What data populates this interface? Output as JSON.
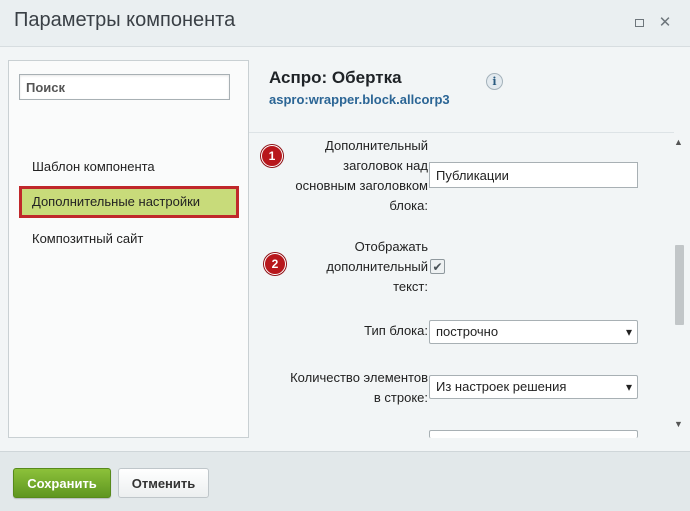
{
  "window": {
    "title": "Параметры компонента"
  },
  "sidebar": {
    "search_placeholder": "Поиск",
    "items": [
      {
        "label": "Шаблон компонента",
        "active": false
      },
      {
        "label": "Дополнительные настройки",
        "active": true
      },
      {
        "label": "Композитный сайт",
        "active": false
      }
    ]
  },
  "component": {
    "name": "Аспро: Обертка",
    "code": "aspro:wrapper.block.allcorp3",
    "info_icon_glyph": "i"
  },
  "form": {
    "fields": [
      {
        "badge": "1",
        "label": "Дополнительный заголовок над основным заголовком блока:",
        "type": "text",
        "value": "Публикации"
      },
      {
        "badge": "2",
        "label": "Отображать дополнительный текст:",
        "type": "checkbox",
        "checked": true,
        "check_glyph": "✔"
      },
      {
        "label": "Тип блока:",
        "type": "select",
        "value": "построчно"
      },
      {
        "label": "Количество элементов в строке:",
        "type": "select",
        "value": "Из настроек решения"
      }
    ]
  },
  "footer": {
    "save_label": "Сохранить",
    "cancel_label": "Отменить"
  },
  "colors": {
    "active_item_bg": "#c8db7a",
    "active_item_border": "#c0282b",
    "badge": "#b8171c",
    "save_button": "#6fa628",
    "component_code": "#2b6595"
  }
}
